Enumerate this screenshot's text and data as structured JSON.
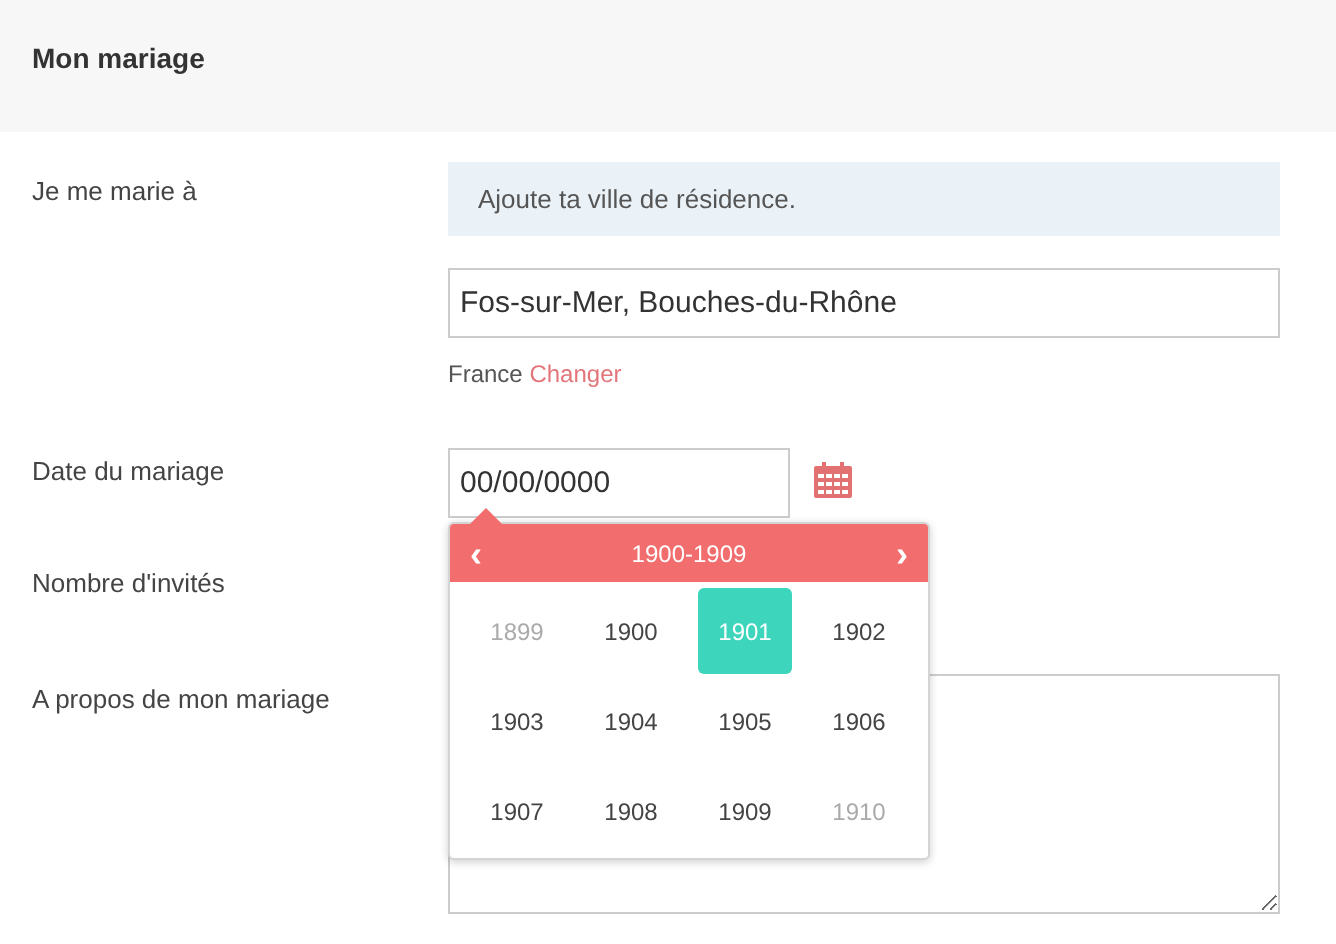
{
  "header": {
    "title": "Mon mariage"
  },
  "form": {
    "location": {
      "label": "Je me marie à",
      "notice": "Ajoute ta ville de résidence.",
      "value": "Fos-sur-Mer, Bouches-du-Rhône",
      "country": "France",
      "change_link": "Changer"
    },
    "date": {
      "label": "Date du mariage",
      "value": "00/00/0000"
    },
    "guests": {
      "label": "Nombre d'invités"
    },
    "about": {
      "label": "A propos de mon mariage"
    }
  },
  "year_picker": {
    "title": "1900-1909",
    "prev": "‹",
    "next": "›",
    "years": [
      {
        "label": "1899",
        "muted": true,
        "selected": false
      },
      {
        "label": "1900",
        "muted": false,
        "selected": false
      },
      {
        "label": "1901",
        "muted": false,
        "selected": true
      },
      {
        "label": "1902",
        "muted": false,
        "selected": false
      },
      {
        "label": "1903",
        "muted": false,
        "selected": false
      },
      {
        "label": "1904",
        "muted": false,
        "selected": false
      },
      {
        "label": "1905",
        "muted": false,
        "selected": false
      },
      {
        "label": "1906",
        "muted": false,
        "selected": false
      },
      {
        "label": "1907",
        "muted": false,
        "selected": false
      },
      {
        "label": "1908",
        "muted": false,
        "selected": false
      },
      {
        "label": "1909",
        "muted": false,
        "selected": false
      },
      {
        "label": "1910",
        "muted": true,
        "selected": false
      }
    ]
  }
}
